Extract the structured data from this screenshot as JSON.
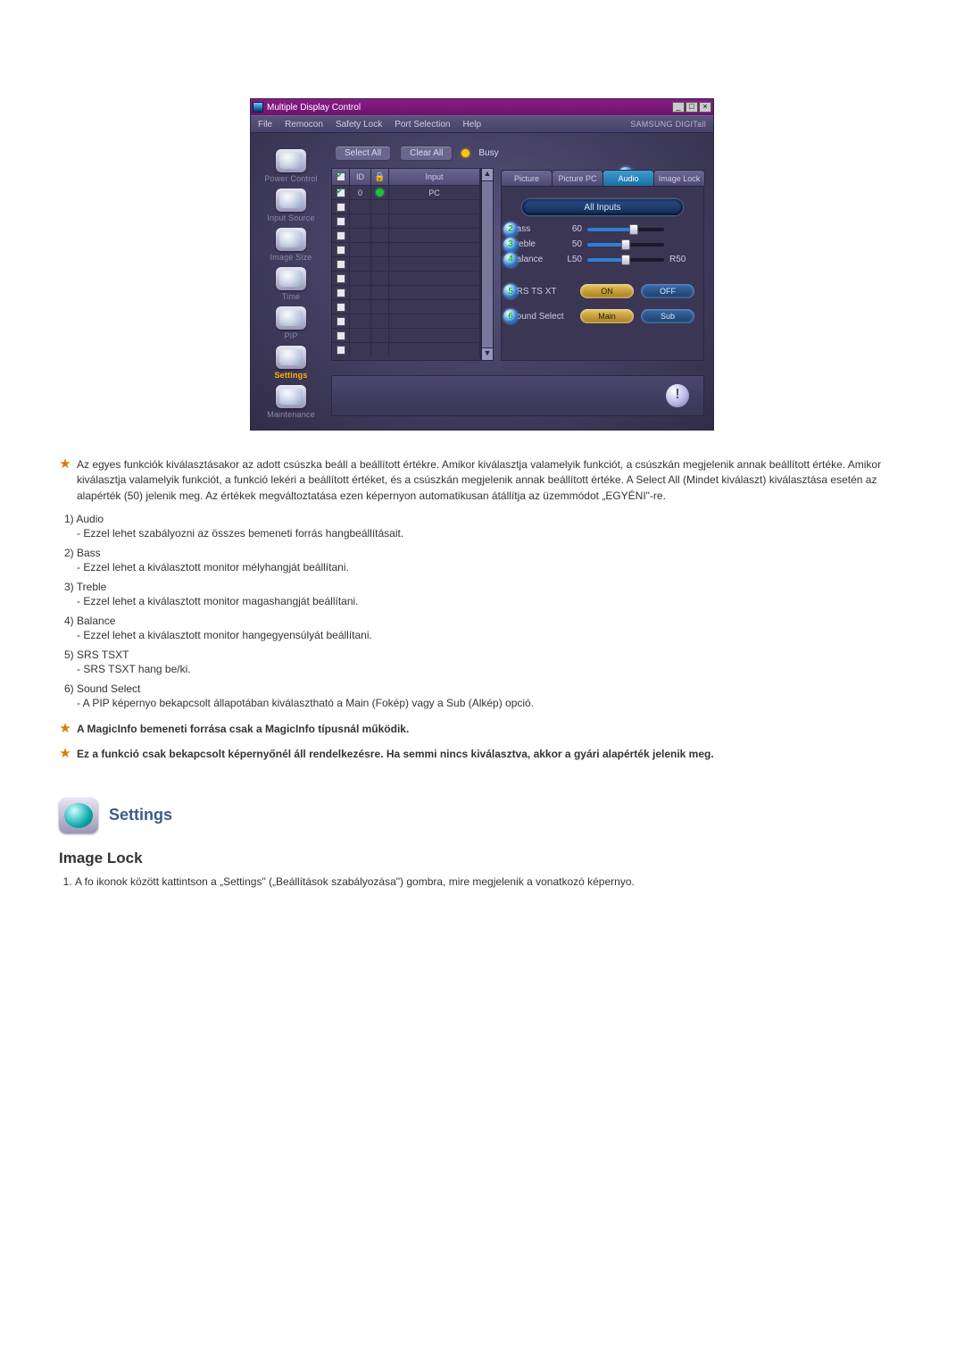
{
  "app": {
    "title": "Multiple Display Control",
    "menu": {
      "file": "File",
      "remocon": "Remocon",
      "safety_lock": "Safety Lock",
      "port_selection": "Port Selection",
      "help": "Help"
    },
    "brand": "SAMSUNG DIGITall",
    "toolbar": {
      "select_all": "Select All",
      "clear_all": "Clear All",
      "busy_label": "Busy"
    },
    "sidebar": {
      "items": [
        {
          "label": "Power Control",
          "cls": "muted"
        },
        {
          "label": "Input Source",
          "cls": "muted"
        },
        {
          "label": "Image Size",
          "cls": "muted"
        },
        {
          "label": "Time",
          "cls": "muted"
        },
        {
          "label": "PIP",
          "cls": "muted"
        },
        {
          "label": "Settings",
          "cls": "active"
        },
        {
          "label": "Maintenance",
          "cls": "muted"
        }
      ]
    },
    "grid": {
      "head": {
        "c1": "ID",
        "c3": "Input"
      },
      "first": {
        "id": "0",
        "input": "PC"
      },
      "blank_rows": 11
    },
    "tabs": {
      "picture": "Picture",
      "picture_pc": "Picture PC",
      "audio": "Audio",
      "image_lock": "Image Lock"
    },
    "panel": {
      "all_inputs": "All Inputs",
      "bass": {
        "label": "Bass",
        "val": "60",
        "pct": 60
      },
      "treble": {
        "label": "Treble",
        "val": "50",
        "pct": 50
      },
      "balance": {
        "label": "Balance",
        "val": "L50",
        "pct": 50,
        "r": "R50"
      },
      "srs": {
        "label": "SRS TS XT",
        "on": "ON",
        "off": "OFF"
      },
      "sound": {
        "label": "Sound Select",
        "main": "Main",
        "sub": "Sub"
      }
    }
  },
  "callouts": {
    "c1": "1",
    "c2": "2",
    "c3": "3",
    "c4": "4",
    "c5": "5",
    "c6": "6"
  },
  "doc": {
    "star1": "Az egyes funkciók kiválasztásakor az adott csúszka beáll a beállított értékre. Amikor kiválasztja valamelyik funkciót, a csúszkán megjelenik annak beállított értéke. Amikor kiválasztja valamelyik funkciót, a funkció lekéri a beállított értéket, és a csúszkán megjelenik annak beállított értéke. A Select All (Mindet kiválaszt) kiválasztása esetén az alapérték (50) jelenik meg. Az értékek megváltoztatása ezen képernyon automatikusan átállítja az üzemmódot „EGYÉNI\"-re.",
    "items": [
      {
        "num": "1)",
        "head": "Audio",
        "sub": "- Ezzel lehet szabályozni az összes bemeneti forrás hangbeállításait."
      },
      {
        "num": "2)",
        "head": "Bass",
        "sub": "- Ezzel lehet a kiválasztott monitor mélyhangját beállítani."
      },
      {
        "num": "3)",
        "head": "Treble",
        "sub": "- Ezzel lehet a kiválasztott monitor magashangját beállítani."
      },
      {
        "num": "4)",
        "head": "Balance",
        "sub": "- Ezzel lehet a kiválasztott monitor hangegyensúlyát beállítani."
      },
      {
        "num": "5)",
        "head": "SRS TSXT",
        "sub": "- SRS TSXT hang be/ki."
      },
      {
        "num": "6)",
        "head": "Sound Select",
        "sub": "- A PIP képernyo bekapcsolt állapotában kiválasztható a Main (Fokép) vagy a Sub (Alkép) opció."
      }
    ],
    "star2": "A MagicInfo bemeneti forrása csak a MagicInfo típusnál működik.",
    "star3": "Ez a funkció csak bekapcsolt képernyőnél áll rendelkezésre. Ha semmi nincs kiválasztva, akkor a gyári alapérték jelenik meg.",
    "section_title": "Settings",
    "h2": "Image Lock",
    "step1": "A fo ikonok között kattintson a „Settings\" („Beállítások szabályozása\") gombra, mire megjelenik a vonatkozó képernyo."
  }
}
